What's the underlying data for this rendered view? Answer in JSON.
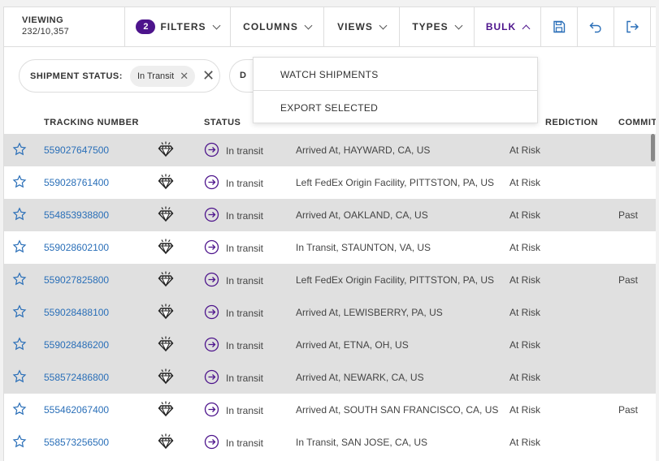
{
  "viewing": {
    "label": "VIEWING",
    "count": "232/10,357"
  },
  "toolbar": {
    "filters_count": "2",
    "filters": "FILTERS",
    "columns": "COLUMNS",
    "views": "VIEWS",
    "types": "TYPES",
    "bulk": "BULK",
    "icons": [
      "save-icon",
      "undo-icon",
      "export-icon"
    ]
  },
  "filter_chip": {
    "key": "SHIPMENT STATUS:",
    "value": "In Transit"
  },
  "filter_chip2": {
    "key": "D"
  },
  "bulk_menu": [
    "WATCH SHIPMENTS",
    "EXPORT SELECTED"
  ],
  "columns": {
    "tracking": "TRACKING NUMBER",
    "status": "STATUS",
    "prediction": "REDICTION",
    "commit": "COMMIT"
  },
  "rows": [
    {
      "tracking": "559027647500",
      "status": "In transit",
      "location": "Arrived At, HAYWARD, CA, US",
      "prediction": "At Risk",
      "commit": ""
    },
    {
      "tracking": "559028761400",
      "status": "In transit",
      "location": "Left FedEx Origin Facility, PITTSTON, PA, US",
      "prediction": "At Risk",
      "commit": ""
    },
    {
      "tracking": "554853938800",
      "status": "In transit",
      "location": "Arrived At, OAKLAND, CA, US",
      "prediction": "At Risk",
      "commit": "Past"
    },
    {
      "tracking": "559028602100",
      "status": "In transit",
      "location": "In Transit, STAUNTON, VA, US",
      "prediction": "At Risk",
      "commit": ""
    },
    {
      "tracking": "559027825800",
      "status": "In transit",
      "location": "Left FedEx Origin Facility, PITTSTON, PA, US",
      "prediction": "At Risk",
      "commit": "Past"
    },
    {
      "tracking": "559028488100",
      "status": "In transit",
      "location": "Arrived At, LEWISBERRY, PA, US",
      "prediction": "At Risk",
      "commit": ""
    },
    {
      "tracking": "559028486200",
      "status": "In transit",
      "location": "Arrived At, ETNA, OH, US",
      "prediction": "At Risk",
      "commit": ""
    },
    {
      "tracking": "558572486800",
      "status": "In transit",
      "location": "Arrived At, NEWARK, CA, US",
      "prediction": "At Risk",
      "commit": ""
    },
    {
      "tracking": "555462067400",
      "status": "In transit",
      "location": "Arrived At, SOUTH SAN FRANCISCO, CA, US",
      "prediction": "At Risk",
      "commit": "Past"
    },
    {
      "tracking": "558573256500",
      "status": "In transit",
      "location": "In Transit, SAN JOSE, CA, US",
      "prediction": "At Risk",
      "commit": ""
    }
  ],
  "colors": {
    "accent": "#4d148c",
    "link": "#2a6fb8",
    "selected_row": "#e0e0e0"
  }
}
